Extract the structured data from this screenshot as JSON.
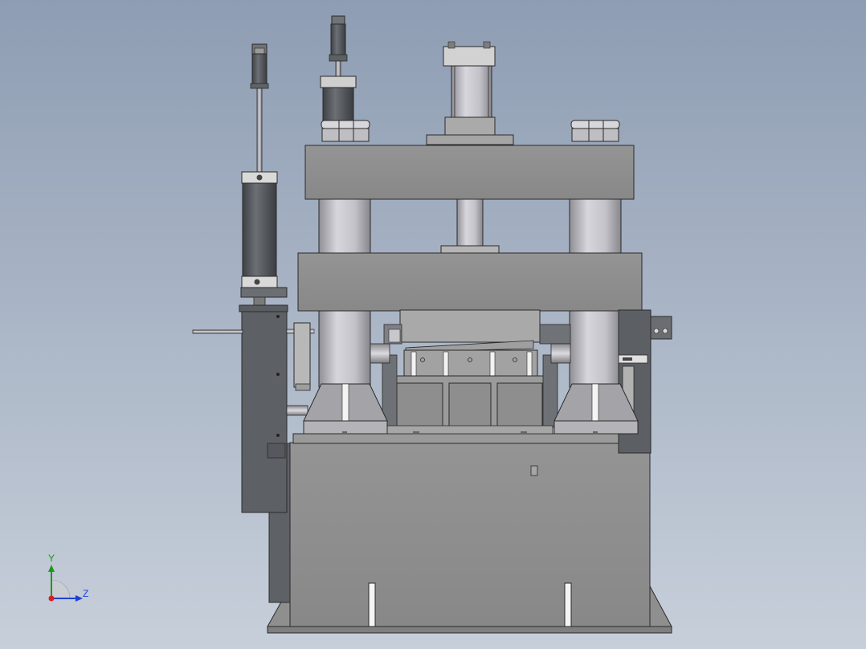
{
  "viewport": {
    "background_top": "#8e9db3",
    "background_bottom": "#c7cfda"
  },
  "triad": {
    "labels": {
      "y": "Y",
      "z": "Z"
    },
    "colors": {
      "y": "#1a9a1a",
      "z": "#1f3fd6",
      "x": "#d42020"
    }
  },
  "model": {
    "part_color": "#8d8d8d",
    "rod_color": "#bfbfc6",
    "cylinder_color": "#5a5e63",
    "edge_color": "#2a2a2a"
  }
}
